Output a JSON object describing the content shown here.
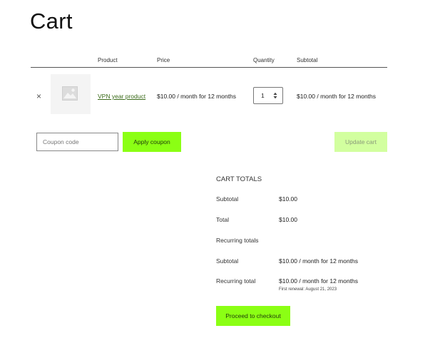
{
  "page": {
    "title": "Cart"
  },
  "table": {
    "headers": {
      "product": "Product",
      "price": "Price",
      "quantity": "Quantity",
      "subtotal": "Subtotal"
    },
    "rows": [
      {
        "remove": "×",
        "name": "VPN year product",
        "price": "$10.00 / month for 12 months",
        "quantity": "1",
        "subtotal": "$10.00 / month for 12 months"
      }
    ]
  },
  "coupon": {
    "placeholder": "Coupon code",
    "apply_label": "Apply coupon",
    "update_label": "Update cart"
  },
  "totals": {
    "title": "CART TOTALS",
    "subtotal_label": "Subtotal",
    "subtotal_value": "$10.00",
    "total_label": "Total",
    "total_value": "$10.00",
    "recurring_heading": "Recurring totals",
    "recurring_subtotal_label": "Subtotal",
    "recurring_subtotal_value": "$10.00 / month for 12 months",
    "recurring_total_label": "Recurring total",
    "recurring_total_value": "$10.00 / month for 12 months",
    "first_renewal": "First renewal: August 21, 2023",
    "checkout_label": "Proceed to checkout"
  },
  "colors": {
    "accent": "#8bff14",
    "accent_disabled": "#d2ff9f",
    "link": "#3b6b1a"
  },
  "icons": {
    "remove": "close-icon",
    "thumbnail": "image-placeholder-icon",
    "quantity_spinner": "spinner-icon"
  }
}
